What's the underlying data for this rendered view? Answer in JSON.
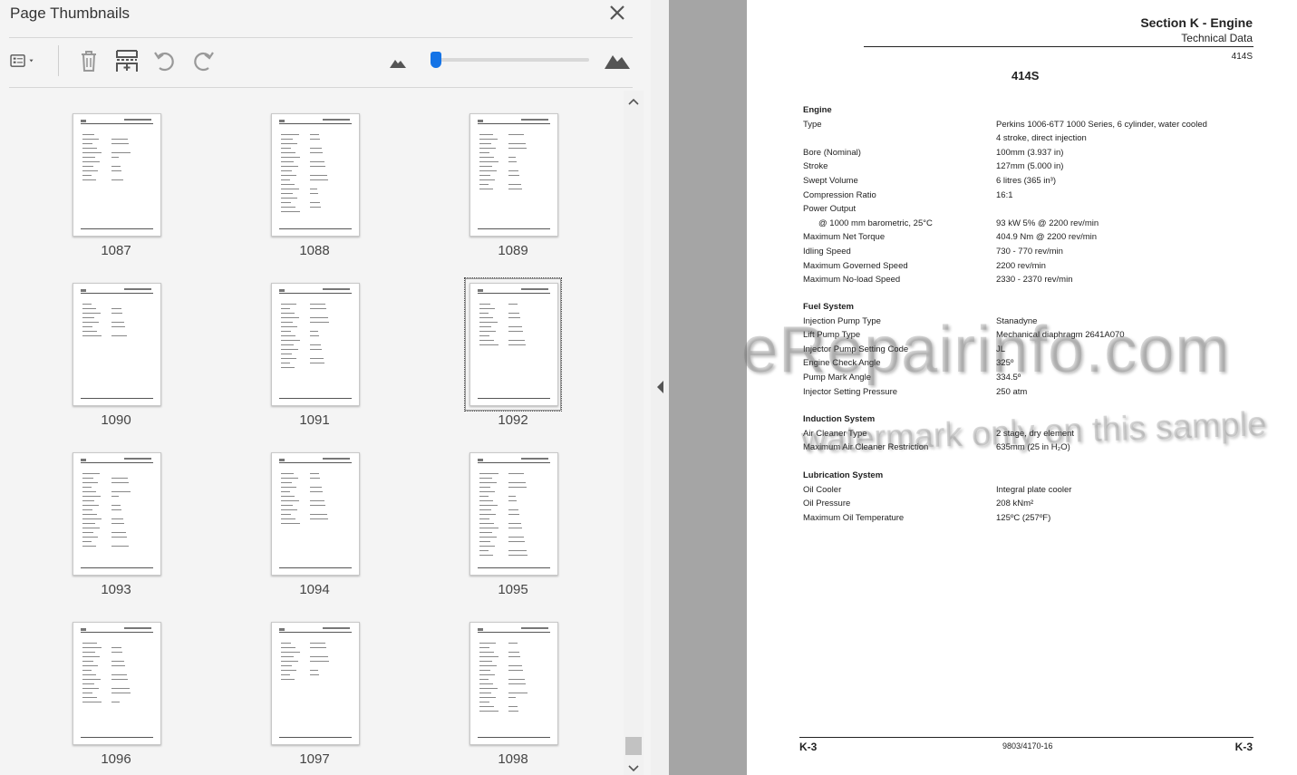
{
  "thumbnails_panel": {
    "title": "Page Thumbnails",
    "toolbar": {
      "options_icon": "thumbnail-options-icon",
      "delete_icon": "trash-icon",
      "insert_icon": "insert-pages-icon",
      "rotate_left_icon": "rotate-counterclockwise-icon",
      "rotate_right_icon": "rotate-clockwise-icon",
      "zoom_out_icon": "mountain-small-icon",
      "zoom_in_icon": "mountain-large-icon",
      "zoom_level": 0.0
    },
    "thumbnails": [
      {
        "label": "1087",
        "selected": false
      },
      {
        "label": "1088",
        "selected": false
      },
      {
        "label": "1089",
        "selected": false
      },
      {
        "label": "1090",
        "selected": false
      },
      {
        "label": "1091",
        "selected": false
      },
      {
        "label": "1092",
        "selected": true
      },
      {
        "label": "1093",
        "selected": false
      },
      {
        "label": "1094",
        "selected": false
      },
      {
        "label": "1095",
        "selected": false
      },
      {
        "label": "1096",
        "selected": false
      },
      {
        "label": "1097",
        "selected": false
      },
      {
        "label": "1098",
        "selected": false
      }
    ],
    "accent_color": "#1473e6"
  },
  "document": {
    "section_title": "Section K - Engine",
    "subsection": "Technical Data",
    "page_code": "414S",
    "model": "414S",
    "sections": [
      {
        "heading": "Engine",
        "rows": [
          {
            "label": "Type",
            "value": "Perkins 1006-6T7 1000 Series, 6 cylinder, water cooled"
          },
          {
            "label": "",
            "value": "4 stroke, direct injection"
          },
          {
            "label": "Bore (Nominal)",
            "value": "100mm (3.937 in)"
          },
          {
            "label": "Stroke",
            "value": "127mm (5.000 in)"
          },
          {
            "label": "Swept Volume",
            "value": "6 litres (365 in³)"
          },
          {
            "label": "Compression Ratio",
            "value": "16:1"
          },
          {
            "label": "Power Output",
            "value": ""
          },
          {
            "label": "@ 1000 mm barometric, 25°C",
            "value": "93 kW 5% @ 2200 rev/min",
            "indent": true
          },
          {
            "label": "Maximum Net Torque",
            "value": "404.9 Nm @ 2200 rev/min"
          },
          {
            "label": "Idling Speed",
            "value": "730 - 770 rev/min"
          },
          {
            "label": "Maximum Governed Speed",
            "value": "2200 rev/min"
          },
          {
            "label": "Maximum No-load Speed",
            "value": "2330 - 2370 rev/min"
          }
        ]
      },
      {
        "heading": "Fuel System",
        "rows": [
          {
            "label": "Injection Pump Type",
            "value": "Stanadyne"
          },
          {
            "label": "Lift Pump Type",
            "value": "Mechanical diaphragm 2641A070"
          },
          {
            "label": "Injector Pump Setting Code",
            "value": "JL"
          },
          {
            "label": "Engine Check Angle",
            "value": "325º"
          },
          {
            "label": "Pump Mark Angle",
            "value": "334.5º"
          },
          {
            "label": "Injector Setting Pressure",
            "value": "250 atm"
          }
        ]
      },
      {
        "heading": "Induction System",
        "rows": [
          {
            "label": "Air Cleaner Type",
            "value": "2 stage, dry element"
          },
          {
            "label": "Maximum Air Cleaner Restriction",
            "value": "635mm (25 in H₂O)"
          }
        ]
      },
      {
        "heading": "Lubrication System",
        "rows": [
          {
            "label": "Oil Cooler",
            "value": "Integral plate cooler"
          },
          {
            "label": "Oil Pressure",
            "value": "208 kNm²"
          },
          {
            "label": "Maximum Oil Temperature",
            "value": "125ºC (257ºF)"
          }
        ]
      }
    ],
    "footer": {
      "left": "K-3",
      "center": "9803/4170-16",
      "right": "K-3"
    },
    "watermark": {
      "line1": "eRepairinfo.com",
      "line2": "watermark only on this sample"
    }
  }
}
